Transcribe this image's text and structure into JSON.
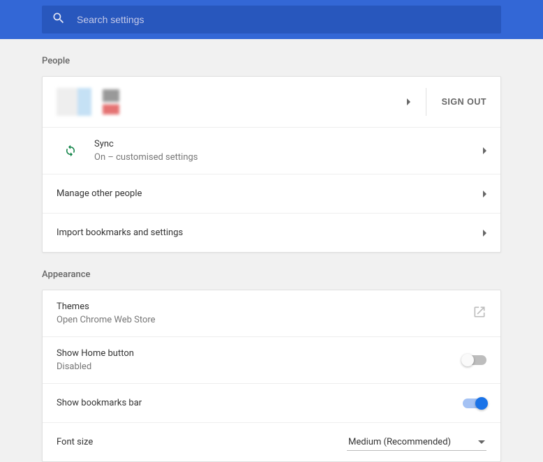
{
  "search": {
    "placeholder": "Search settings"
  },
  "sections": {
    "people": {
      "title": "People",
      "sign_out": "SIGN OUT",
      "sync": {
        "title": "Sync",
        "sub": "On – customised settings"
      },
      "manage": "Manage other people",
      "import": "Import bookmarks and settings"
    },
    "appearance": {
      "title": "Appearance",
      "themes": {
        "title": "Themes",
        "sub": "Open Chrome Web Store"
      },
      "home": {
        "title": "Show Home button",
        "sub": "Disabled",
        "on": false
      },
      "bookmarks": {
        "title": "Show bookmarks bar",
        "on": true
      },
      "font": {
        "title": "Font size",
        "value": "Medium (Recommended)"
      }
    }
  }
}
